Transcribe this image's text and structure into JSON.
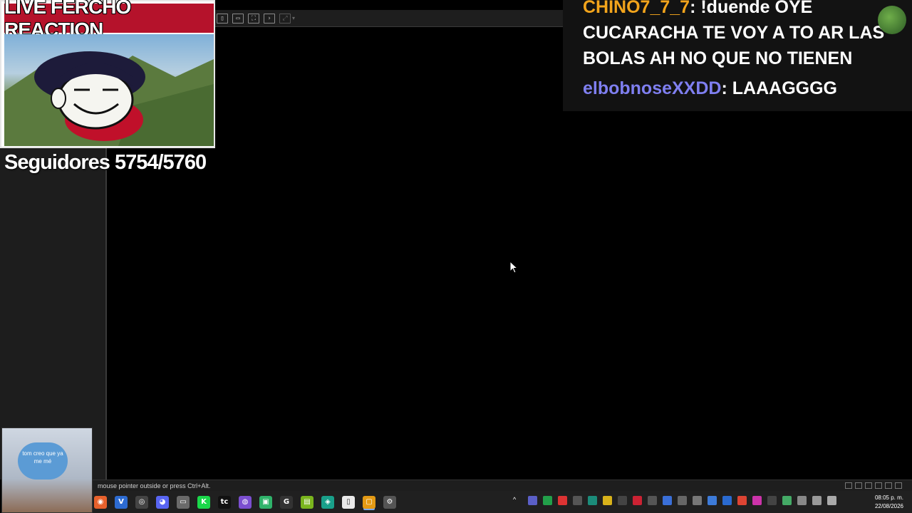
{
  "overlay": {
    "title": "LIVE FERCHO REACTION",
    "followers": "Seguidores 5754/5760"
  },
  "chat": {
    "messages": [
      {
        "user": "CHINO7_7_7",
        "text": ": !duende OYE CUCARACHA TE VOY A TO AR LAS BOLAS AH NO QUE NO TIENEN"
      },
      {
        "user": "elbobnoseXXDD",
        "text": ": LAAAGGGG"
      }
    ]
  },
  "webcam": {
    "bubble_text": "tom creo que ya me mé"
  },
  "status_bar": {
    "text": "mouse pointer outside or press Ctrl+Alt."
  },
  "clock": {
    "time": "08:05 p. m.",
    "date": "22/08/2026"
  },
  "taskbar": {
    "apps": [
      {
        "icon": "firefox-icon",
        "glyph": "◉",
        "color": "#e8612c"
      },
      {
        "icon": "visual-studio-icon",
        "glyph": "V",
        "color": "#2d6bd1"
      },
      {
        "icon": "obs-icon",
        "glyph": "◎",
        "color": "#444"
      },
      {
        "icon": "discord-icon",
        "glyph": "◕",
        "color": "#5865f2"
      },
      {
        "icon": "file-explorer-icon",
        "glyph": "▭",
        "color": "#6a6a6a"
      },
      {
        "icon": "kick-icon",
        "glyph": "K",
        "color": "#1ad84a"
      },
      {
        "icon": "tc-all-icon",
        "glyph": "tc",
        "color": "#111"
      },
      {
        "icon": "messenger-icon",
        "glyph": "◍",
        "color": "#7b4fd0"
      },
      {
        "icon": "app-green-icon",
        "glyph": "▣",
        "color": "#2fb36a"
      },
      {
        "icon": "chrome-icon",
        "glyph": "G",
        "color": "#333"
      },
      {
        "icon": "notes-icon",
        "glyph": "▤",
        "color": "#7ab51d"
      },
      {
        "icon": "app-teal-icon",
        "glyph": "◈",
        "color": "#19a08a"
      },
      {
        "icon": "document-icon",
        "glyph": "▯",
        "color": "#eaeaea"
      },
      {
        "icon": "virtualbox-icon",
        "glyph": "▢",
        "color": "#e39a14"
      },
      {
        "icon": "settings-icon",
        "glyph": "⚙",
        "color": "#555"
      }
    ]
  }
}
